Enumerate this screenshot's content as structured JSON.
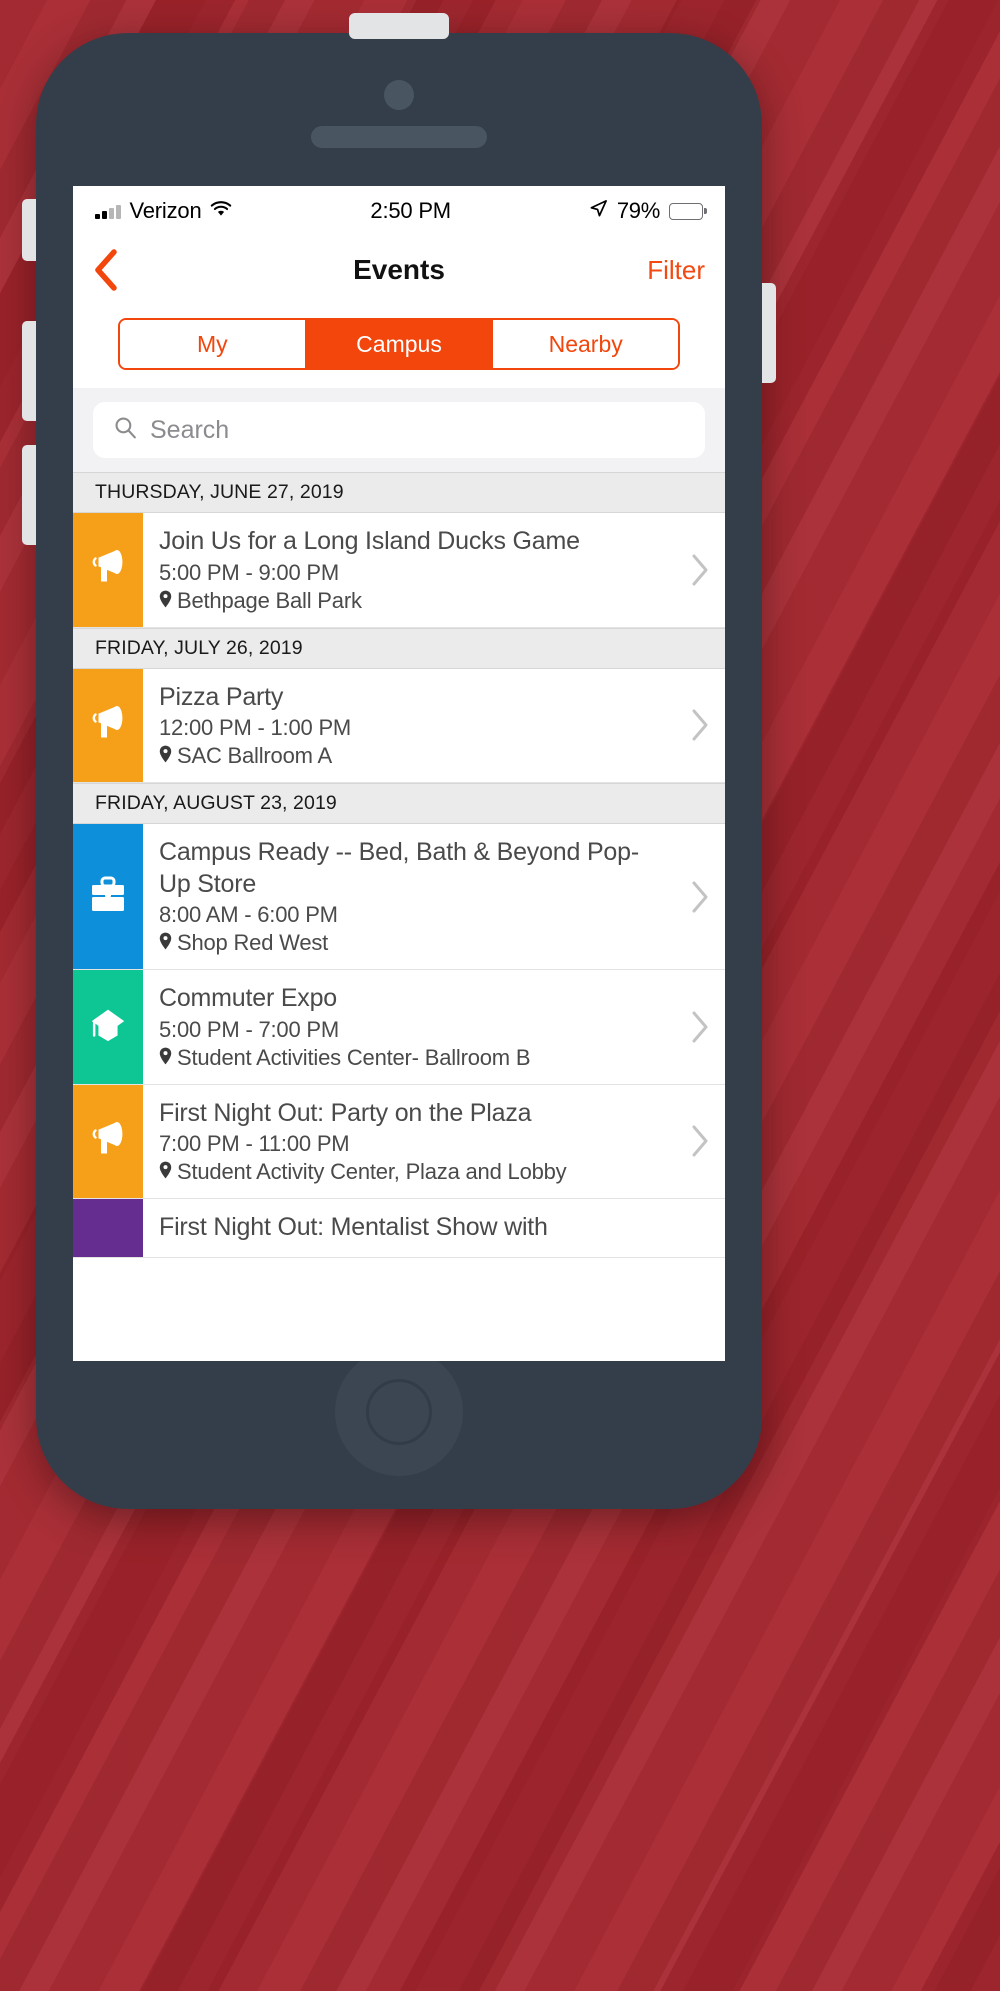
{
  "device": {
    "frame_color": "#343e4a",
    "backdrop_color": "#a82b33"
  },
  "status_bar": {
    "carrier": "Verizon",
    "signal_icon": "signal-bars-icon",
    "wifi_icon": "wifi-icon",
    "time": "2:50 PM",
    "location_icon": "location-arrow-icon",
    "battery_percent": "79%",
    "battery_icon": "battery-icon"
  },
  "nav_bar": {
    "back_icon": "back-chevron-icon",
    "title": "Events",
    "filter_label": "Filter",
    "accent_color": "#f2460d"
  },
  "segmented_control": {
    "options": [
      {
        "label": "My",
        "active": false
      },
      {
        "label": "Campus",
        "active": true
      },
      {
        "label": "Nearby",
        "active": false
      }
    ],
    "accent_color": "#f2460d"
  },
  "search": {
    "icon": "search-icon",
    "placeholder": "Search",
    "value": ""
  },
  "list": {
    "groups": [
      {
        "date": "THURSDAY, JUNE 27, 2019",
        "events": [
          {
            "title": "Join Us for a Long Island Ducks Game",
            "time": "5:00 PM - 9:00 PM",
            "location": "Bethpage Ball Park",
            "tile_color": "#f6a01a",
            "tile_icon": "megaphone-icon",
            "chevron_icon": "chevron-right-icon"
          }
        ]
      },
      {
        "date": "FRIDAY, JULY 26, 2019",
        "events": [
          {
            "title": "Pizza Party",
            "time": "12:00 PM - 1:00 PM",
            "location": "SAC Ballroom A",
            "tile_color": "#f6a01a",
            "tile_icon": "megaphone-icon",
            "chevron_icon": "chevron-right-icon"
          }
        ]
      },
      {
        "date": "FRIDAY, AUGUST 23, 2019",
        "events": [
          {
            "title": "Campus Ready -- Bed, Bath & Beyond Pop-Up Store",
            "time": "8:00 AM - 6:00 PM",
            "location": "Shop Red West",
            "tile_color": "#0d8fd9",
            "tile_icon": "briefcase-icon",
            "chevron_icon": "chevron-right-icon"
          },
          {
            "title": "Commuter Expo",
            "time": "5:00 PM - 7:00 PM",
            "location": "Student Activities Center- Ballroom B",
            "tile_color": "#0ec693",
            "tile_icon": "graduation-cap-icon",
            "chevron_icon": "chevron-right-icon"
          },
          {
            "title": "First Night Out: Party on the Plaza",
            "time": "7:00 PM - 11:00 PM",
            "location": "Student Activity Center, Plaza and Lobby",
            "tile_color": "#f6a01a",
            "tile_icon": "megaphone-icon",
            "chevron_icon": "chevron-right-icon"
          },
          {
            "title": "First Night Out: Mentalist Show with",
            "time": "",
            "location": "",
            "tile_color": "#662d91",
            "tile_icon": "",
            "chevron_icon": "",
            "truncated": true
          }
        ]
      }
    ]
  }
}
